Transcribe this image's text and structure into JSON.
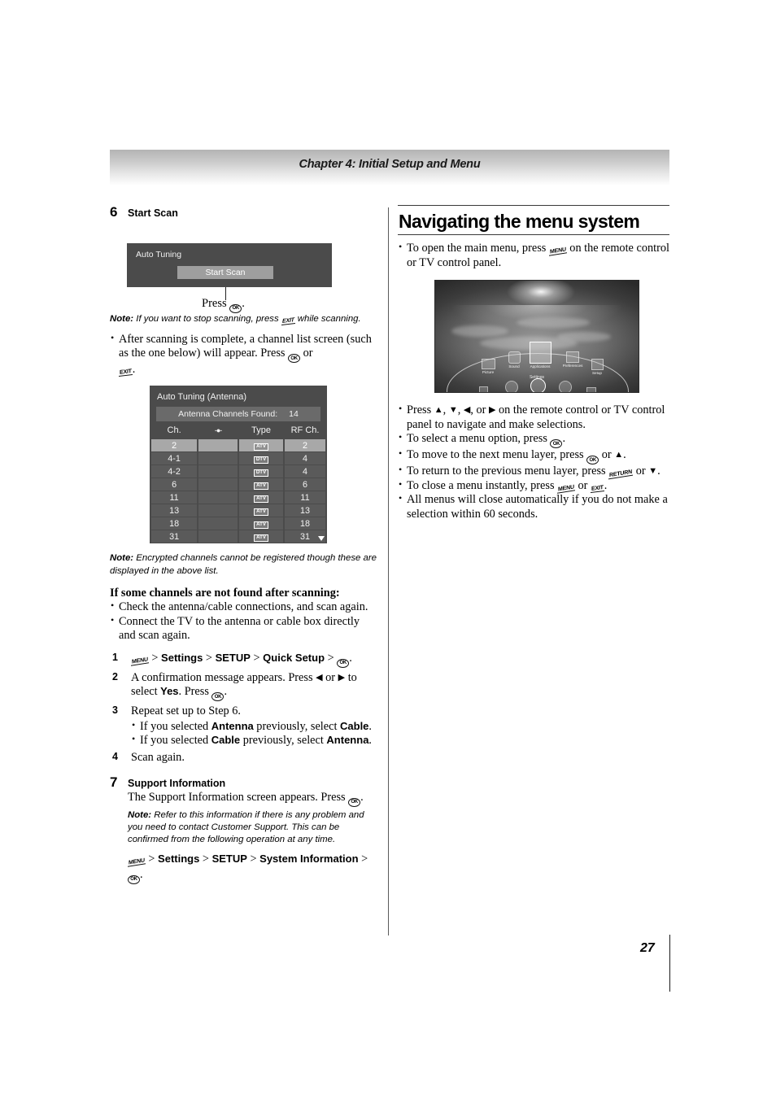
{
  "header": {
    "chapter": "Chapter 4: Initial Setup and Menu"
  },
  "page": {
    "number": "27"
  },
  "left": {
    "step6": {
      "num": "6",
      "title": "Start Scan"
    },
    "auto_tuning_dialog": {
      "title": "Auto Tuning",
      "button": "Start Scan",
      "caption_prefix": "Press",
      "caption_suffix": "."
    },
    "note1": {
      "label": "Note:",
      "text_before": "If you want to stop scanning, press",
      "icon": "exit-icon",
      "text_after": "while scanning."
    },
    "bullet_after_scan": {
      "part1": "After scanning is complete, a channel list screen (such as the one below) will appear. Press",
      "mid": "or",
      "end": "."
    },
    "channel_table": {
      "title": "Auto Tuning (Antenna)",
      "found_label": "Antenna Channels Found:",
      "found_count": "14",
      "headers": [
        "Ch.",
        "lock-icon",
        "Type",
        "RF Ch."
      ],
      "rows": [
        {
          "ch": "2",
          "lock": "",
          "type": "ATV",
          "rf": "2",
          "selected": true
        },
        {
          "ch": "4-1",
          "lock": "",
          "type": "DTV",
          "rf": "4",
          "selected": false
        },
        {
          "ch": "4-2",
          "lock": "",
          "type": "DTV",
          "rf": "4",
          "selected": false
        },
        {
          "ch": "6",
          "lock": "",
          "type": "ATV",
          "rf": "6",
          "selected": false
        },
        {
          "ch": "11",
          "lock": "",
          "type": "ATV",
          "rf": "11",
          "selected": false
        },
        {
          "ch": "13",
          "lock": "",
          "type": "ATV",
          "rf": "13",
          "selected": false
        },
        {
          "ch": "18",
          "lock": "",
          "type": "ATV",
          "rf": "18",
          "selected": false
        },
        {
          "ch": "31",
          "lock": "",
          "type": "ATV",
          "rf": "31",
          "selected": false
        }
      ]
    },
    "note2": {
      "label": "Note:",
      "text": "Encrypted channels cannot be registered though these are displayed in the above list."
    },
    "not_found_head": "If some channels are not found after scanning:",
    "not_found_bullets": [
      "Check the antenna/cable connections, and scan again.",
      "Connect the TV to the antenna or cable box directly and scan again."
    ],
    "steps": {
      "s1": {
        "n": "1",
        "path": [
          "Settings",
          "SETUP",
          "Quick Setup"
        ],
        "sep": ">",
        "end": "."
      },
      "s2": {
        "n": "2",
        "t1": "A confirmation message appears. Press",
        "t2": "or",
        "t3": "to select",
        "yes": "Yes",
        "t4": ". Press",
        "t5": "."
      },
      "s3": {
        "n": "3",
        "main": "Repeat set up to Step 6.",
        "sub": [
          {
            "a": "If you selected ",
            "b": "Antenna",
            "c": " previously,  select ",
            "d": "Cable",
            "e": "."
          },
          {
            "a": "If you selected ",
            "b": "Cable",
            "c": " previously, select ",
            "d": "Antenna",
            "e": "."
          }
        ]
      },
      "s4": {
        "n": "4",
        "main": "Scan again."
      }
    },
    "step7": {
      "num": "7",
      "title": "Support Information",
      "line": "The Support Information screen appears. Press",
      "line_end": ".",
      "note_label": "Note:",
      "note_text": "Refer to this information if there is any problem and you need to contact Customer Support. This can be confirmed from the following operation at any time.",
      "path": [
        "Settings",
        "SETUP",
        "System Information"
      ],
      "sep": ">",
      "path_end": "."
    }
  },
  "right": {
    "section_title": "Navigating the menu system",
    "bullet_open": {
      "t1": "To open the main menu, press",
      "t2": "on the remote control or TV control panel."
    },
    "tv_menu": {
      "items": [
        {
          "label": "Picture",
          "icon": "picture-icon",
          "selected": false
        },
        {
          "label": "Sound",
          "icon": "sound-icon",
          "selected": false
        },
        {
          "label": "Applications",
          "icon": "applications-icon",
          "selected": true
        },
        {
          "label": "Preferences",
          "icon": "preferences-icon",
          "selected": false
        },
        {
          "label": "Setup",
          "icon": "setup-icon",
          "selected": false
        }
      ],
      "group_label": "Settings"
    },
    "bullets": [
      {
        "t1": "Press",
        "t2": ", ",
        "t3": ", ",
        "t4": ", or ",
        "t5": "on the remote control or TV control panel to navigate and make selections."
      },
      {
        "t1": "To select a menu option, press",
        "t2": "."
      },
      {
        "t1": "To move to the next menu layer, press",
        "t2": "or",
        "t3": "."
      },
      {
        "t1": "To return to the previous menu layer, press",
        "t2": "or",
        "t3": "."
      },
      {
        "t1": "To close a menu instantly, press",
        "t2": "or",
        "t3": "."
      },
      {
        "t1": "All menus will close automatically if you do not make a selection within 60 seconds."
      }
    ]
  },
  "icons": {
    "ok": "OK",
    "exit": "EXIT",
    "menu": "MENU",
    "return": "RETURN",
    "up": "▲",
    "down": "▼",
    "left": "◀",
    "right": "▶"
  },
  "colors": {
    "dialog_bg": "#4b4b4b",
    "button_bg": "#9e9e9e",
    "row_bg": "#5a5a5a",
    "row_selected_bg": "#a8a8a8",
    "header_band_top": "#b4b4b4"
  }
}
